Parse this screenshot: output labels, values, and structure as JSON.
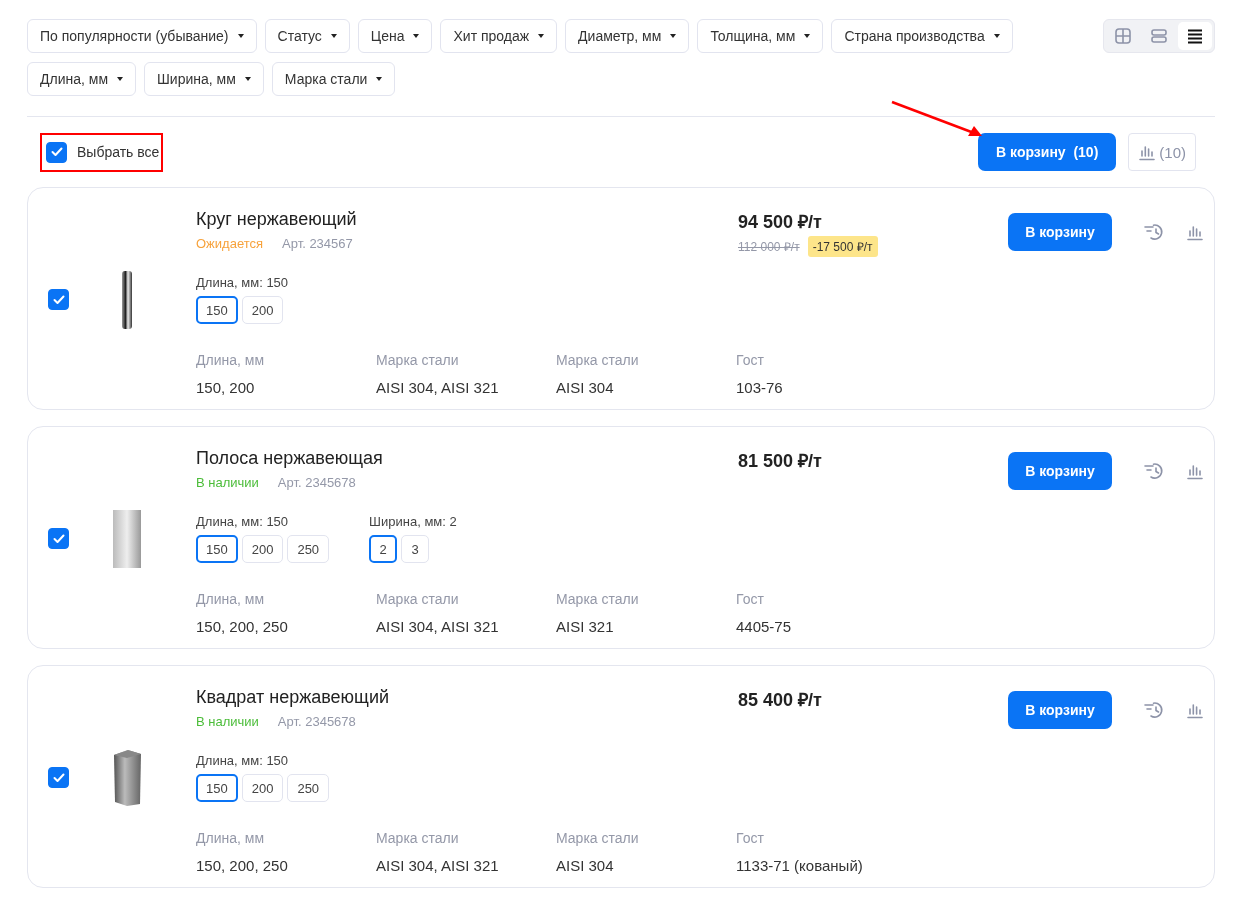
{
  "filters": [
    {
      "label": "По популярности (убывание)"
    },
    {
      "label": "Статус"
    },
    {
      "label": "Цена"
    },
    {
      "label": "Хит продаж"
    },
    {
      "label": "Диаметр, мм"
    },
    {
      "label": "Толщина, мм"
    },
    {
      "label": "Страна производства"
    },
    {
      "label": "Длина, мм"
    },
    {
      "label": "Ширина, мм"
    },
    {
      "label": "Марка стали"
    }
  ],
  "view_modes": [
    {
      "kind": "grid",
      "selected": false
    },
    {
      "kind": "rows",
      "selected": false
    },
    {
      "kind": "list",
      "selected": true
    }
  ],
  "select_all": {
    "label": "Выбрать все",
    "checked": true
  },
  "cart_button": {
    "label": "В корзину",
    "count": "(10)"
  },
  "compare_button": {
    "count": "(10)"
  },
  "products": [
    {
      "kind": "rod",
      "checked": true,
      "name": "Круг нержавеющий",
      "status": {
        "text": "Ожидается",
        "kind": "expected"
      },
      "article": "Арт. 234567",
      "price": "94 500 ₽/т",
      "old_price": "112 000 ₽/т",
      "discount": "-17 500 ₽/т",
      "cart_label": "В корзину",
      "options": [
        {
          "label": "Длина, мм: 150",
          "values": [
            {
              "text": "150",
              "selected": true
            },
            {
              "text": "200",
              "selected": false
            }
          ]
        }
      ],
      "attributes": [
        {
          "name": "Длина, мм",
          "value": "150, 200"
        },
        {
          "name": "Марка стали",
          "value": "AISI 304, AISI 321"
        },
        {
          "name": "Марка стали",
          "value": "AISI 304"
        },
        {
          "name": "Гост",
          "value": "103-76"
        }
      ]
    },
    {
      "kind": "strip",
      "checked": true,
      "name": "Полоса нержавеющая",
      "status": {
        "text": "В наличии",
        "kind": "in_stock"
      },
      "article": "Арт. 2345678",
      "price": "81 500 ₽/т",
      "cart_label": "В корзину",
      "options": [
        {
          "label": "Длина, мм: 150",
          "values": [
            {
              "text": "150",
              "selected": true
            },
            {
              "text": "200",
              "selected": false
            },
            {
              "text": "250",
              "selected": false
            }
          ]
        },
        {
          "label": "Ширина, мм: 2",
          "values": [
            {
              "text": "2",
              "selected": true
            },
            {
              "text": "3",
              "selected": false
            }
          ]
        }
      ],
      "attributes": [
        {
          "name": "Длина, мм",
          "value": "150, 200, 250"
        },
        {
          "name": "Марка стали",
          "value": "AISI 304, AISI 321"
        },
        {
          "name": "Марка стали",
          "value": "AISI 321"
        },
        {
          "name": "Гост",
          "value": "4405-75"
        }
      ]
    },
    {
      "kind": "bar",
      "checked": true,
      "name": "Квадрат нержавеющий",
      "status": {
        "text": "В наличии",
        "kind": "in_stock"
      },
      "article": "Арт. 2345678",
      "price": "85 400 ₽/т",
      "cart_label": "В корзину",
      "options": [
        {
          "label": "Длина, мм: 150",
          "values": [
            {
              "text": "150",
              "selected": true
            },
            {
              "text": "200",
              "selected": false
            },
            {
              "text": "250",
              "selected": false
            }
          ]
        }
      ],
      "attributes": [
        {
          "name": "Длина, мм",
          "value": "150, 200, 250"
        },
        {
          "name": "Марка стали",
          "value": "AISI 304, AISI 321"
        },
        {
          "name": "Марка стали",
          "value": "AISI 304"
        },
        {
          "name": "Гост",
          "value": "1133-71 (кованый)"
        }
      ]
    }
  ]
}
